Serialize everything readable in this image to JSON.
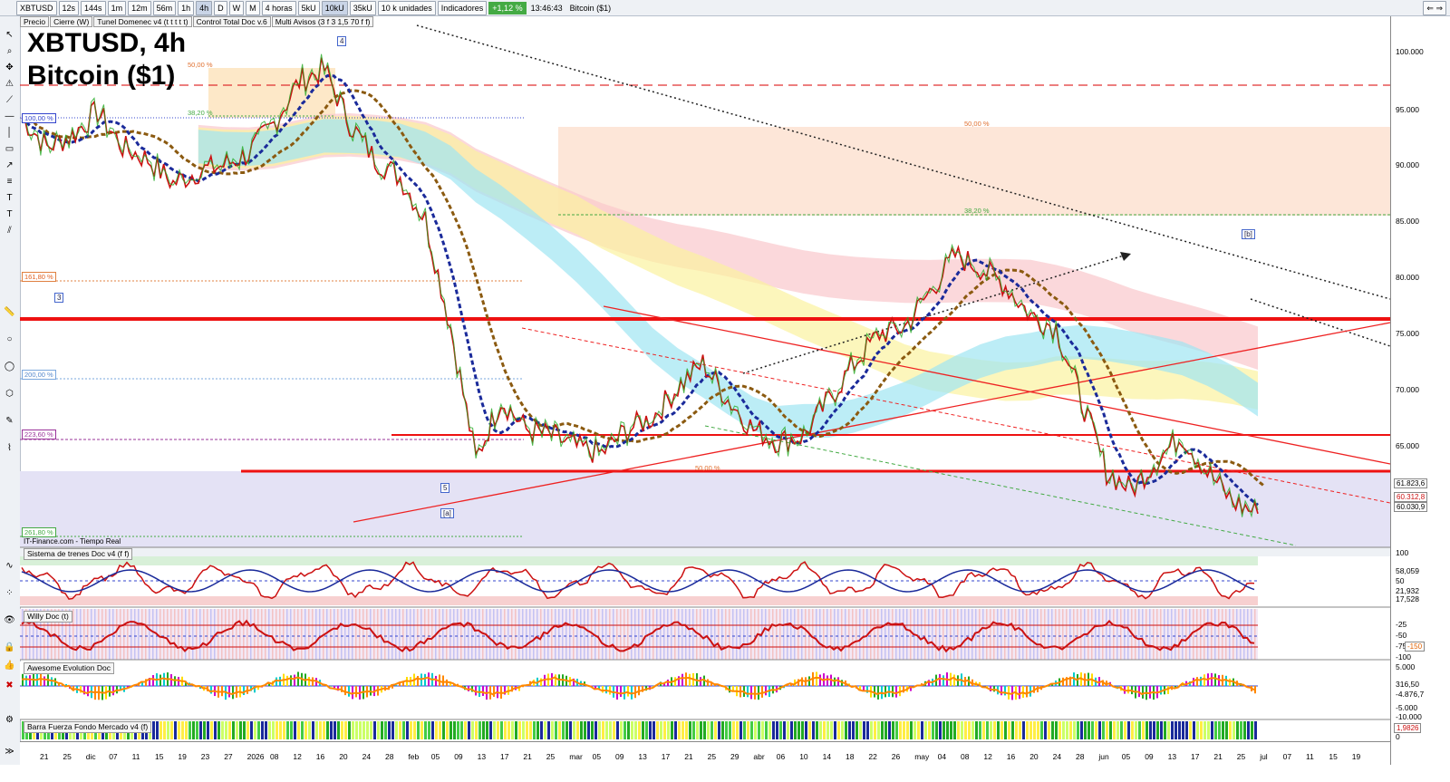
{
  "toolbar": {
    "symbol": "XBTUSD",
    "intervals": [
      "12s",
      "144s",
      "1m",
      "12m",
      "56m",
      "1h",
      "4h",
      "D",
      "W",
      "M"
    ],
    "active_interval": "4h",
    "period": "4 horas",
    "units": [
      "5kU",
      "10kU",
      "35kU"
    ],
    "active_unit": "10kU",
    "units_select": "10 k unidades",
    "indicators_label": "Indicadores",
    "change": "+1,12 %",
    "time": "13:46:43",
    "instrument": "Bitcoin ($1)"
  },
  "chart_tabs": [
    "Precio",
    "Cierre (W)",
    "Tunel Domenec v4 (t t t t t)",
    "Control Total Doc v.6",
    "Multi Avisos (3 f 3 1,5 70 f f)"
  ],
  "title": {
    "line1": "XBTUSD, 4h",
    "line2": "Bitcoin ($1)"
  },
  "source": "IT-Finance.com - Tiempo Real",
  "panes": [
    "Sistema de trenes Doc v4 (f f)",
    "Willy Doc (t)",
    "Awesome Evolution Doc",
    "Barra Fuerza Fondo Mercado v4 (f)"
  ],
  "price_axis": [
    "100.000",
    "95.000",
    "90.000",
    "85.000",
    "80.000",
    "75.000",
    "70.000",
    "65.000"
  ],
  "price_labels": {
    "p1": "61.823,6",
    "p2": "60.312,8",
    "p3": "60.030,9"
  },
  "osc1_axis": [
    "100",
    "58,059",
    "50",
    "21,932",
    "17,528"
  ],
  "osc2_axis": [
    "-25",
    "-50",
    "-75",
    "-100"
  ],
  "osc2_value": "-150",
  "osc3_axis": [
    "5.000",
    "316,50",
    "-4.876,7",
    "-5.000"
  ],
  "osc4_axis": [
    "-10.000",
    "1,9826",
    "0"
  ],
  "fib_left": [
    "100,00 %",
    "161,80 %",
    "200,00 %",
    "223,60 %",
    "261,80 %"
  ],
  "fib_top": [
    "50,00 %",
    "38,20 %"
  ],
  "fib_right": [
    "50,00 %",
    "38,20 %",
    "50,00 %"
  ],
  "wave_labels": [
    "4",
    "3",
    "5",
    "[a]",
    "[b]"
  ],
  "x_axis": [
    "21",
    "25",
    "dic",
    "07",
    "11",
    "15",
    "19",
    "23",
    "27",
    "2026",
    "08",
    "12",
    "16",
    "20",
    "24",
    "28",
    "feb",
    "05",
    "09",
    "13",
    "17",
    "21",
    "25",
    "mar",
    "05",
    "09",
    "13",
    "17",
    "21",
    "25",
    "29",
    "abr",
    "06",
    "10",
    "14",
    "18",
    "22",
    "26",
    "may",
    "04",
    "08",
    "12",
    "16",
    "20",
    "24",
    "28",
    "jun",
    "05",
    "09",
    "13",
    "17",
    "21",
    "25",
    "jul",
    "07",
    "11",
    "15",
    "19"
  ],
  "chart_data": {
    "type": "line",
    "title": "XBTUSD, 4h",
    "subtitle": "Bitcoin ($1)",
    "series": [
      {
        "name": "XBTUSD",
        "values": [
          93500,
          91000,
          92000,
          94000,
          91000,
          90000,
          88000,
          89000,
          89500,
          90500,
          93000,
          96500,
          97500,
          93000,
          90000,
          88500,
          85000,
          76000,
          65000,
          70000,
          67500,
          67000,
          66000,
          65500,
          67500,
          68500,
          71000,
          73000,
          70000,
          67500,
          66500,
          67000,
          70000,
          73000,
          75500,
          76000,
          79000,
          82000,
          81000,
          79500,
          77000,
          76000,
          70000,
          64000,
          62500,
          65000,
          67000,
          64000,
          61500,
          60500
        ]
      }
    ],
    "ylim": [
      58000,
      101000
    ],
    "levels": [
      97000,
      76200,
      66000,
      62800
    ]
  }
}
